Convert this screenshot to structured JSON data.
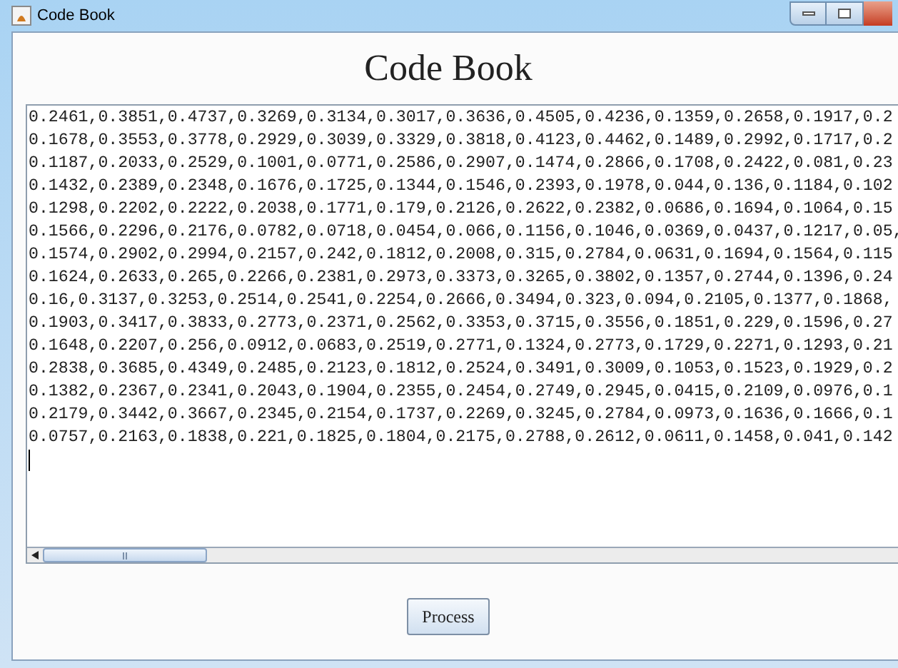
{
  "window": {
    "title": "Code Book"
  },
  "heading": "Code Book",
  "text_area": {
    "lines": [
      "0.2461,0.3851,0.4737,0.3269,0.3134,0.3017,0.3636,0.4505,0.4236,0.1359,0.2658,0.1917,0.2",
      "0.1678,0.3553,0.3778,0.2929,0.3039,0.3329,0.3818,0.4123,0.4462,0.1489,0.2992,0.1717,0.2",
      "0.1187,0.2033,0.2529,0.1001,0.0771,0.2586,0.2907,0.1474,0.2866,0.1708,0.2422,0.081,0.23",
      "0.1432,0.2389,0.2348,0.1676,0.1725,0.1344,0.1546,0.2393,0.1978,0.044,0.136,0.1184,0.102",
      "0.1298,0.2202,0.2222,0.2038,0.1771,0.179,0.2126,0.2622,0.2382,0.0686,0.1694,0.1064,0.15",
      "0.1566,0.2296,0.2176,0.0782,0.0718,0.0454,0.066,0.1156,0.1046,0.0369,0.0437,0.1217,0.05,",
      "0.1574,0.2902,0.2994,0.2157,0.242,0.1812,0.2008,0.315,0.2784,0.0631,0.1694,0.1564,0.115",
      "0.1624,0.2633,0.265,0.2266,0.2381,0.2973,0.3373,0.3265,0.3802,0.1357,0.2744,0.1396,0.24",
      "0.16,0.3137,0.3253,0.2514,0.2541,0.2254,0.2666,0.3494,0.323,0.094,0.2105,0.1377,0.1868,",
      "0.1903,0.3417,0.3833,0.2773,0.2371,0.2562,0.3353,0.3715,0.3556,0.1851,0.229,0.1596,0.27",
      "0.1648,0.2207,0.256,0.0912,0.0683,0.2519,0.2771,0.1324,0.2773,0.1729,0.2271,0.1293,0.21",
      "0.2838,0.3685,0.4349,0.2485,0.2123,0.1812,0.2524,0.3491,0.3009,0.1053,0.1523,0.1929,0.2",
      "0.1382,0.2367,0.2341,0.2043,0.1904,0.2355,0.2454,0.2749,0.2945,0.0415,0.2109,0.0976,0.1",
      "0.2179,0.3442,0.3667,0.2345,0.2154,0.1737,0.2269,0.3245,0.2784,0.0973,0.1636,0.1666,0.1",
      "0.0757,0.2163,0.1838,0.221,0.1825,0.1804,0.2175,0.2788,0.2612,0.0611,0.1458,0.041,0.142"
    ]
  },
  "button": "Process"
}
